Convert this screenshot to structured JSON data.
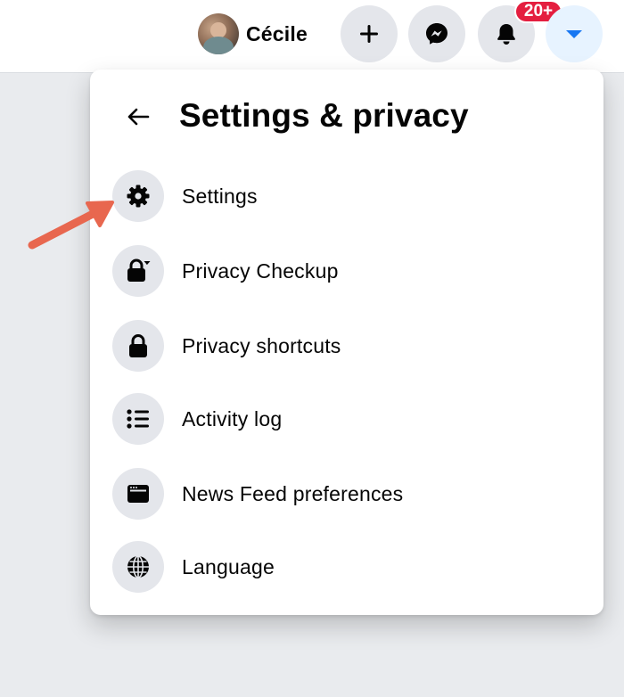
{
  "header": {
    "profile_name": "Cécile",
    "notification_badge": "20+",
    "buttons": {
      "create": "plus-icon",
      "messenger": "messenger-icon",
      "notifications": "bell-icon",
      "account": "caret-down-icon"
    }
  },
  "dropdown": {
    "title": "Settings & privacy",
    "back_icon": "back-arrow-icon",
    "items": [
      {
        "label": "Settings",
        "icon": "gear-icon"
      },
      {
        "label": "Privacy Checkup",
        "icon": "lock-checkup-icon"
      },
      {
        "label": "Privacy shortcuts",
        "icon": "lock-icon"
      },
      {
        "label": "Activity log",
        "icon": "list-icon"
      },
      {
        "label": "News Feed preferences",
        "icon": "feed-window-icon"
      },
      {
        "label": "Language",
        "icon": "globe-icon"
      }
    ]
  },
  "colors": {
    "accent": "#1877f2",
    "badge": "#e41e3f",
    "annotation_arrow": "#e8674f"
  }
}
